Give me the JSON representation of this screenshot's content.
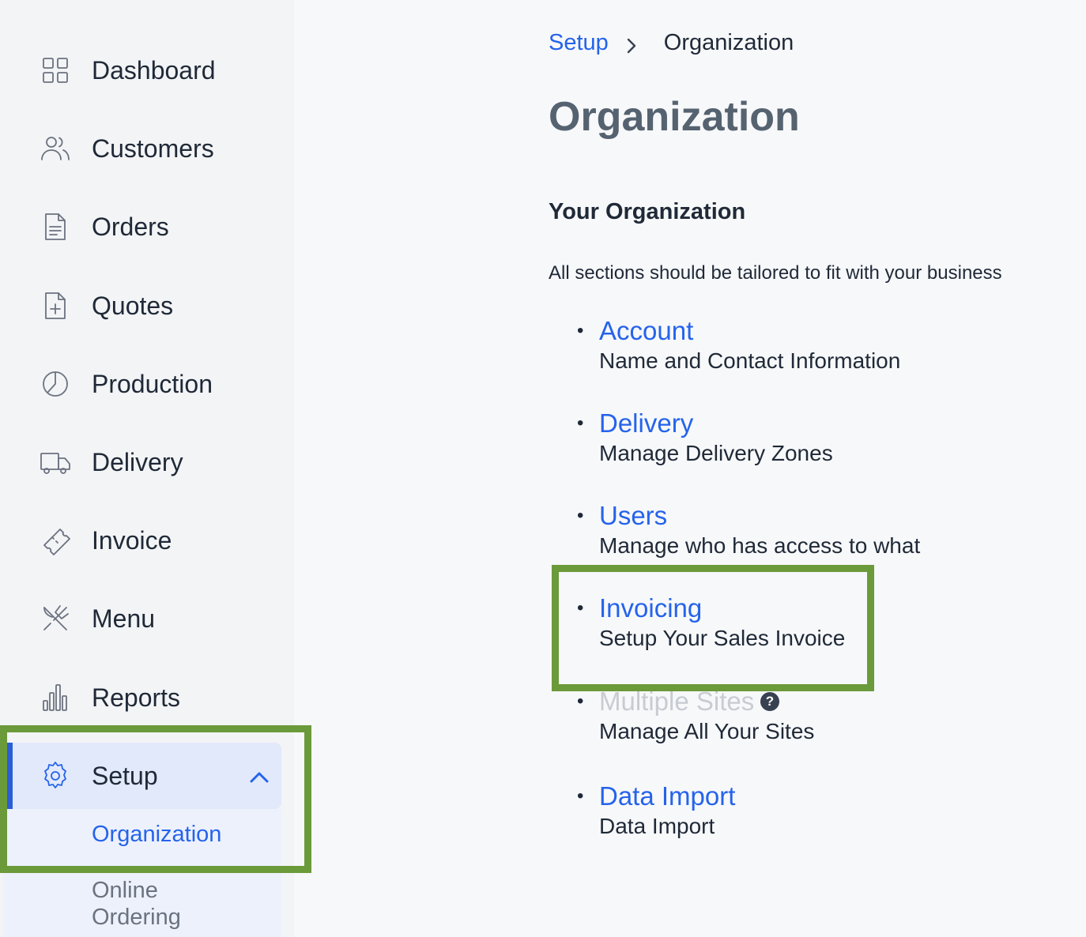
{
  "sidebar": {
    "items": [
      {
        "label": "Dashboard",
        "icon": "dashboard-icon"
      },
      {
        "label": "Customers",
        "icon": "users-icon"
      },
      {
        "label": "Orders",
        "icon": "document-icon"
      },
      {
        "label": "Quotes",
        "icon": "document-plus-icon"
      },
      {
        "label": "Production",
        "icon": "pie-chart-icon"
      },
      {
        "label": "Delivery",
        "icon": "truck-icon"
      },
      {
        "label": "Invoice",
        "icon": "ticket-icon"
      },
      {
        "label": "Menu",
        "icon": "utensils-icon"
      },
      {
        "label": "Reports",
        "icon": "bar-chart-icon"
      },
      {
        "label": "Setup",
        "icon": "gear-icon"
      }
    ],
    "submenu": [
      {
        "label": "Organization"
      },
      {
        "label": "Online Ordering"
      }
    ]
  },
  "breadcrumb": {
    "parent": "Setup",
    "current": "Organization"
  },
  "main": {
    "title": "Organization",
    "section_title": "Your Organization",
    "section_desc": "All sections should be tailored to fit with your business",
    "list": [
      {
        "link": "Account",
        "desc": "Name and Contact Information"
      },
      {
        "link": "Delivery",
        "desc": "Manage Delivery Zones"
      },
      {
        "link": "Users",
        "desc": "Manage who has access to what"
      },
      {
        "link": "Invoicing",
        "desc": "Setup Your Sales Invoice"
      },
      {
        "link": "Multiple Sites",
        "desc": "Manage All Your Sites"
      },
      {
        "link": "Data Import",
        "desc": "Data Import"
      }
    ],
    "help_glyph": "?"
  },
  "colors": {
    "accent": "#2563eb",
    "highlight_border": "#6b9a3a",
    "active_bg": "#e2e9fb",
    "title": "#556270"
  }
}
